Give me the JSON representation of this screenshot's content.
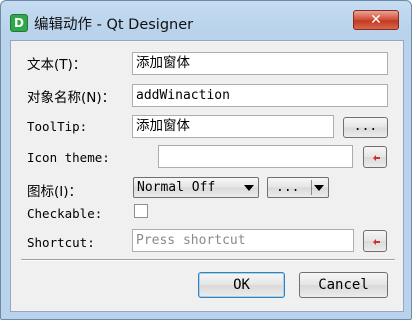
{
  "window": {
    "icon_letter": "D",
    "title": "编辑动作 - Qt Designer",
    "close_glyph": "✕"
  },
  "form": {
    "text": {
      "label": "文本(T)：",
      "value": "添加窗体"
    },
    "object_name": {
      "label": "对象名称(N)：",
      "value": "addWinaction"
    },
    "tooltip": {
      "label": "ToolTip:",
      "value": "添加窗体",
      "button": "..."
    },
    "icon_theme": {
      "label": "Icon theme:",
      "value": ""
    },
    "icon": {
      "label": "图标(I)：",
      "combo_value": "Normal Off",
      "button": "..."
    },
    "checkable": {
      "label": "Checkable:",
      "checked": false
    },
    "shortcut": {
      "label": "Shortcut:",
      "placeholder": "Press shortcut"
    }
  },
  "buttons": {
    "ok": "OK",
    "cancel": "Cancel"
  },
  "icons": {
    "close": "close-icon",
    "reset": "reset-arrow-icon",
    "dropdown": "chevron-down-icon",
    "app": "qt-designer-icon"
  },
  "colors": {
    "title_bar": "#b9d3ec",
    "close_button": "#c23a22",
    "reset_arrow": "#d32f2f",
    "dialog_bg": "#f0f0f0"
  }
}
